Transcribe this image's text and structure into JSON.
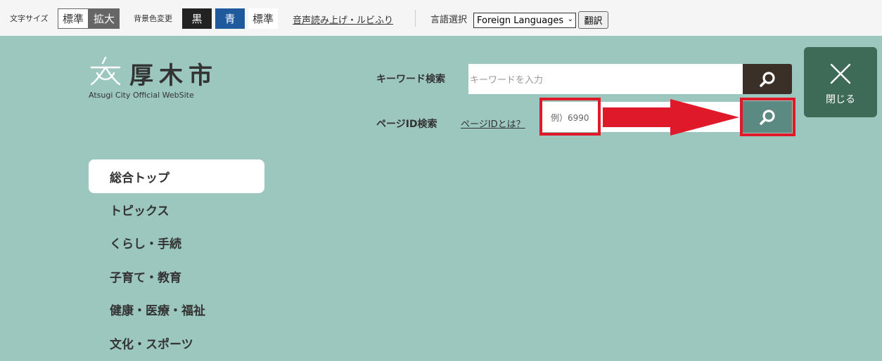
{
  "topbar": {
    "font_size_label": "文字サイズ",
    "font_size_standard": "標準",
    "font_size_large": "拡大",
    "bg_color_label": "背景色変更",
    "bg_black": "黒",
    "bg_blue": "青",
    "bg_standard": "標準",
    "voice_link": "音声読み上げ・ルビふり",
    "language_label": "言語選択",
    "language_selected": "Foreign Languages",
    "translate_button": "翻訳"
  },
  "logo": {
    "title": "厚木市",
    "subtitle": "Atsugi City Official WebSite"
  },
  "search": {
    "keyword_label": "キーワード検索",
    "keyword_placeholder": "キーワードを入力",
    "pageid_label": "ページID検索",
    "pageid_help_link": "ページIDとは？",
    "pageid_placeholder": "例）6990"
  },
  "close": {
    "label": "閉じる"
  },
  "nav": {
    "items": [
      {
        "label": "総合トップ",
        "active": true
      },
      {
        "label": "トピックス"
      },
      {
        "label": "くらし・手続"
      },
      {
        "label": "子育て・教育"
      },
      {
        "label": "健康・医療・福祉"
      },
      {
        "label": "文化・スポーツ"
      }
    ]
  },
  "colors": {
    "background": "#9cc7be",
    "highlight": "#e0192a",
    "keyword_button": "#3a3028",
    "pageid_button": "#5a8a82",
    "close_button": "#3e6a58"
  },
  "icons": {
    "search": "magnifier-icon",
    "close": "close-x-icon",
    "logo": "atsugi-city-logo-icon"
  }
}
